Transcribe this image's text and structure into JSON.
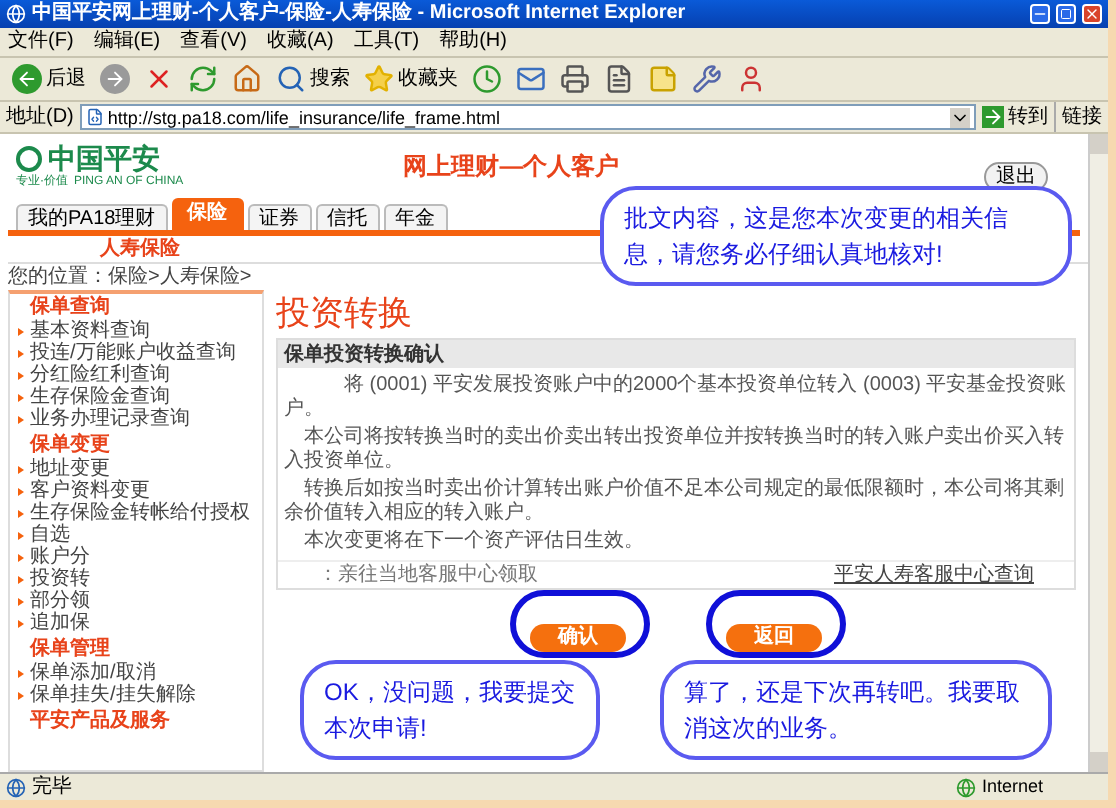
{
  "window": {
    "title": "中国平安网上理财-个人客户-保险-人寿保险 - Microsoft Internet Explorer"
  },
  "menu": [
    "文件(F)",
    "编辑(E)",
    "查看(V)",
    "收藏(A)",
    "工具(T)",
    "帮助(H)"
  ],
  "toolbar": [
    {
      "kind": "back",
      "label": "后退"
    },
    {
      "kind": "forward"
    },
    {
      "kind": "stop"
    },
    {
      "kind": "refresh"
    },
    {
      "kind": "home"
    },
    {
      "kind": "search",
      "label": "搜索"
    },
    {
      "kind": "favorites",
      "label": "收藏夹"
    },
    {
      "kind": "history"
    },
    {
      "kind": "mail"
    },
    {
      "kind": "print"
    },
    {
      "kind": "edit"
    },
    {
      "kind": "note"
    },
    {
      "kind": "tools"
    },
    {
      "kind": "messenger"
    }
  ],
  "address": {
    "label": "地址(D)",
    "url": "http://stg.pa18.com/life_insurance/life_frame.html",
    "go": "转到",
    "links": "链接"
  },
  "header": {
    "logo": "中国平安",
    "logo_en": "PING AN OF CHINA",
    "slogan": "专业·价值",
    "title": "网上理财—个人客户",
    "logout": "退出"
  },
  "tabs": [
    {
      "label": "我的PA18理财",
      "selected": false
    },
    {
      "label": "保险",
      "selected": true
    },
    {
      "label": "证券",
      "selected": false
    },
    {
      "label": "信托",
      "selected": false
    },
    {
      "label": "年金",
      "selected": false
    }
  ],
  "subtab": "人寿保险",
  "breadcrumb": "您的位置：保险>人寿保险>",
  "sidebar": [
    {
      "title": "保单查询",
      "items": [
        "基本资料查询",
        "投连/万能账户收益查询",
        "分红险红利查询",
        "生存保险金查询",
        "业务办理记录查询"
      ]
    },
    {
      "title": "保单变更",
      "items": [
        "地址变更",
        "客户资料变更",
        "生存保险金转帐给付授权",
        "自选",
        "账户分",
        "投资转",
        "部分领",
        "追加保"
      ]
    },
    {
      "title": "保单管理",
      "items": [
        "保单添加/取消",
        "保单挂失/挂失解除"
      ]
    },
    {
      "title": "平安产品及服务"
    }
  ],
  "main": {
    "title": "投资转换",
    "box_title": "保单投资转换确认",
    "paragraphs": [
      "将 (0001) 平安发展投资账户中的2000个基本投资单位转入 (0003) 平安基金投资账户。",
      "本公司将按转换当时的卖出价卖出转出投资单位并按转换当时的转入账户卖出价买入转入投资单位。",
      "转换后如按当时卖出价计算转出账户价值不足本公司规定的最低限额时，本公司将其剩余价值转入相应的转入账户。",
      "本次变更将在下一个资产评估日生效。"
    ],
    "note": "：亲往当地客服中心领取",
    "link": "平安人寿客服中心查询",
    "confirm": "确认",
    "back": "返回"
  },
  "callouts": [
    "批文内容，这是您本次变更的相关信息，请您务必仔细认真地核对!",
    "OK，没问题，我要提交本次申请!",
    "算了，还是下次再转吧。我要取消这次的业务。"
  ],
  "status_bar": {
    "text": "完毕",
    "zone": "Internet"
  }
}
